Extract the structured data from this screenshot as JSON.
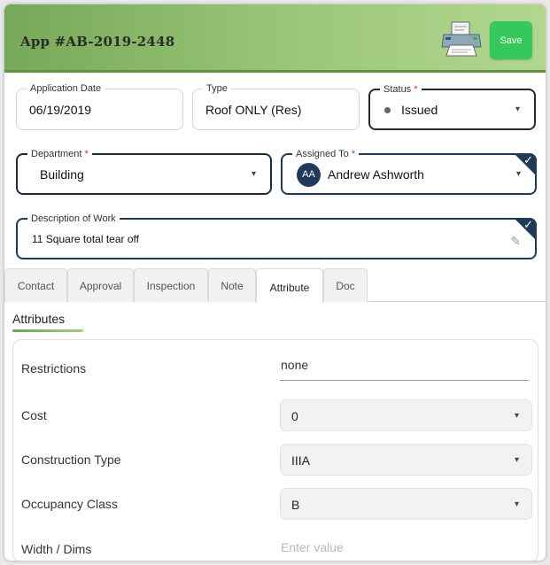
{
  "header": {
    "title": "App #AB-2019-2448",
    "save_label": "Save",
    "print_icon": "printer-icon",
    "colors": {
      "gradient_start": "#76a957",
      "gradient_end": "#b2d78f",
      "save": "#35c85a"
    }
  },
  "fields": {
    "application_date": {
      "label": "Application Date",
      "value": "06/19/2019"
    },
    "type": {
      "label": "Type",
      "value": "Roof ONLY (Res)"
    },
    "status": {
      "label": "Status",
      "required_mark": "*",
      "value": "Issued"
    },
    "department": {
      "label": "Department",
      "required_mark": "*",
      "value": "Building"
    },
    "assigned_to": {
      "label": "Assigned To",
      "required_mark": "*",
      "initials": "AA",
      "value": "Andrew Ashworth"
    },
    "description": {
      "label": "Description of Work",
      "value": "11 Square total tear off"
    }
  },
  "tabs": [
    {
      "label": "Contact"
    },
    {
      "label": "Approval"
    },
    {
      "label": "Inspection"
    },
    {
      "label": "Note"
    },
    {
      "label": "Attribute",
      "active": true
    },
    {
      "label": "Doc"
    }
  ],
  "attributes": {
    "title": "Attributes",
    "rows": [
      {
        "label": "Restrictions",
        "value": "none"
      },
      {
        "label": "Cost",
        "value": "0"
      },
      {
        "label": "Construction Type",
        "value": "IIIA"
      },
      {
        "label": "Occupancy Class",
        "value": "B"
      },
      {
        "label": "Width / Dims",
        "value": "Enter value"
      }
    ]
  },
  "icons": {
    "caret": "▾",
    "check": "✓",
    "pencil": "✎"
  }
}
